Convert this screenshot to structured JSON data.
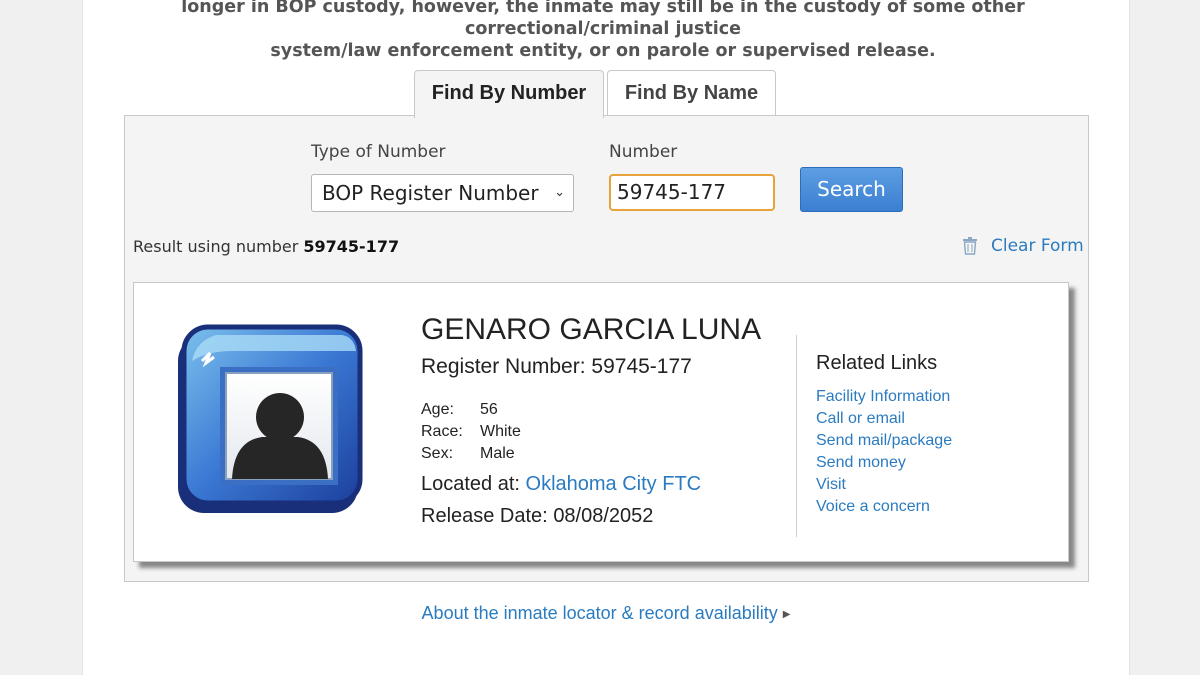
{
  "notice": {
    "line1": "longer in BOP custody, however, the inmate may still be in the custody of some other correctional/criminal justice",
    "line2": "system/law enforcement entity, or on parole or supervised release."
  },
  "tabs": [
    {
      "label": "Find By Number",
      "active": true
    },
    {
      "label": "Find By Name",
      "active": false
    }
  ],
  "form": {
    "type_label": "Type of Number",
    "type_value": "BOP Register Number",
    "number_label": "Number",
    "number_value": "59745-177",
    "search_label": "Search",
    "clear_label": "Clear Form"
  },
  "result": {
    "prefix": "Result using number",
    "number": "59745-177"
  },
  "inmate": {
    "name": "GENARO GARCIA LUNA",
    "register_label": "Register Number:",
    "register_number": "59745-177",
    "age_label": "Age:",
    "age": "56",
    "race_label": "Race:",
    "race": "White",
    "sex_label": "Sex:",
    "sex": "Male",
    "located_label": "Located at:",
    "facility": "Oklahoma City FTC",
    "release_label": "Release Date:",
    "release_date": "08/08/2052"
  },
  "related": {
    "title": "Related Links",
    "links": [
      "Facility Information",
      "Call or email",
      "Send mail/package",
      "Send money",
      "Visit",
      "Voice a concern"
    ]
  },
  "footer": {
    "about_label": "About the inmate locator & record availability"
  },
  "colors": {
    "link": "#2b7bc0",
    "button": "#3a7fd1",
    "input_focus": "#e7a23c",
    "panel_bg": "#f4f4f4"
  }
}
